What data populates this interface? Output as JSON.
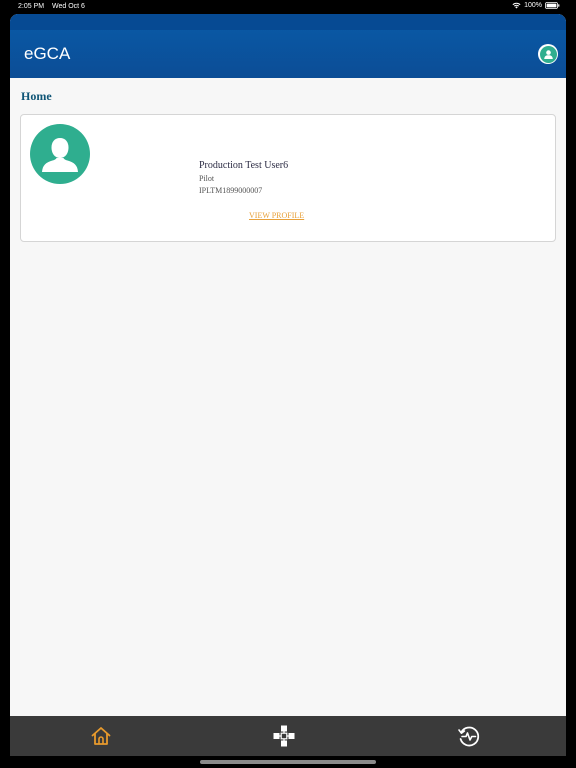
{
  "status_bar": {
    "time": "2:05 PM",
    "date": "Wed Oct 6",
    "battery": "100%",
    "wifi_icon": "wifi-icon",
    "battery_icon": "battery-icon"
  },
  "header": {
    "title": "eGCA",
    "profile_icon": "user-icon"
  },
  "page": {
    "title": "Home"
  },
  "user_card": {
    "name": "Production Test User6",
    "role": "Pilot",
    "id": "IPLTM1899000007",
    "view_profile_label": "VIEW PROFILE",
    "avatar_icon": "person-silhouette-icon"
  },
  "bottom_nav": {
    "items": [
      {
        "icon": "home-icon",
        "active": true
      },
      {
        "icon": "services-network-icon",
        "active": false
      },
      {
        "icon": "activity-history-icon",
        "active": false
      }
    ]
  },
  "colors": {
    "header_blue": "#0b4d96",
    "accent_teal": "#2fae8f",
    "title_blue": "#0f5576",
    "link_orange": "#e8a13a",
    "active_tab_orange": "#e89a2c",
    "bottom_bar": "#3a3a3a"
  }
}
